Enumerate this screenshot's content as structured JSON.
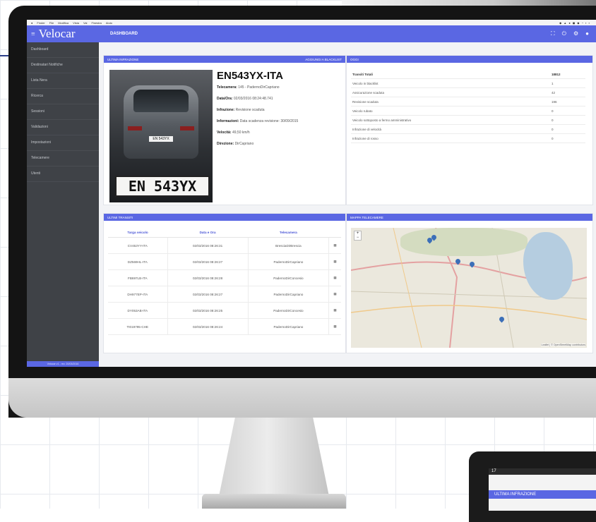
{
  "menubar": {
    "items": [
      "Finder",
      "File",
      "Modifica",
      "Vista",
      "Vai",
      "Finestra",
      "Aiuto"
    ]
  },
  "app": {
    "logo": "Velocar",
    "page_title": "DASHBOARD"
  },
  "sidebar": {
    "items": [
      "Dashboard",
      "Destinatari Notifiche",
      "Lista Nera",
      "Ricerca",
      "Sessioni",
      "Validazioni",
      "Impostazioni",
      "Telecamere",
      "Utenti"
    ],
    "footer": "Velocar v1 - rev. 20/03/2016"
  },
  "infraction": {
    "panel_title": "ULTIMA INFRAZIONE",
    "blacklist_action": "AGGIUNGI A BLACKLIST",
    "plate_number": "EN543YX-ITA",
    "plate_crop_text": "EN 543YX",
    "car_plate_text": "EN 543YX",
    "camera_label": "Telecamera:",
    "camera_value": "145 - PadernoDirCapriano",
    "datetime_label": "Data/Ora:",
    "datetime_value": "02/03/2016 08:24:48.741",
    "infraction_label": "Infrazione:",
    "infraction_value": "Revisione scaduta",
    "info_label": "Informazioni:",
    "info_value": "Data scadenza revisione: 30/09/2015",
    "speed_label": "Velocità:",
    "speed_value": "49,50 km/h",
    "direction_label": "Direzione:",
    "direction_value": "DirCapriano"
  },
  "today": {
    "panel_title": "OGGI",
    "rows": [
      {
        "label": "Transiti Totali",
        "value": "18812"
      },
      {
        "label": "Veicolo in blacklist",
        "value": "1"
      },
      {
        "label": "Assicurazione scaduta",
        "value": "42"
      },
      {
        "label": "Revisione scaduta",
        "value": "196"
      },
      {
        "label": "Veicolo rubato",
        "value": "0"
      },
      {
        "label": "Veicolo sottoposto a fermo amministrativo",
        "value": "0"
      },
      {
        "label": "Infrazione di velocità",
        "value": "0"
      },
      {
        "label": "Infrazione di rosso",
        "value": "0"
      }
    ]
  },
  "transits": {
    "panel_title": "ULTIMI TRANSITI",
    "headers": [
      "Targa veicolo",
      "Data e Ora",
      "Telecamera"
    ],
    "rows": [
      {
        "plate": "CV453YY-ITA",
        "datetime": "02/03/2016 08:26:31",
        "camera": "BresciaDirBrescia"
      },
      {
        "plate": "DZ569HL-ITA",
        "datetime": "02/03/2016 08:26:27",
        "camera": "PadernoDirCapriano"
      },
      {
        "plate": "FB697LB-ITA",
        "datetime": "02/03/2016 08:26:28",
        "camera": "PadernoDirConcesio"
      },
      {
        "plate": "DH977EP-ITA",
        "datetime": "02/03/2016 08:26:27",
        "camera": "PadernoDirCapriano"
      },
      {
        "plate": "DY053AB-ITA",
        "datetime": "02/03/2016 08:26:25",
        "camera": "PadernoDirConcesio"
      },
      {
        "plate": "TI019795-CHE",
        "datetime": "02/03/2016 08:26:24",
        "camera": "PadernoDirCapriano"
      }
    ]
  },
  "map": {
    "panel_title": "MAPPA TELECAMERE",
    "zoom_in": "+",
    "zoom_out": "−",
    "attribution": "Leaflet | © OpenStreetMap contributors"
  },
  "tablet": {
    "title": "ULTIMA INFRAZIONE",
    "status_text": "17"
  }
}
